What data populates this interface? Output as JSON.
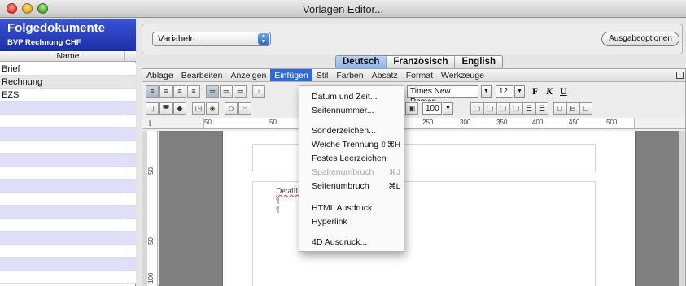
{
  "window": {
    "title": "Vorlagen Editor..."
  },
  "sidebar": {
    "title": "Folgedokumente",
    "subtitle": "BVP Rechnung CHF",
    "column_header": "Name",
    "items": [
      "Brief",
      "Rechnung",
      "EZS",
      "",
      "",
      "",
      "",
      "",
      "",
      "",
      "",
      "",
      "",
      "",
      "",
      "",
      ""
    ]
  },
  "topbar": {
    "variables_popup": "Variabeln...",
    "output_options_button": "Ausgabeoptionen"
  },
  "language_tabs": [
    "Deutsch",
    "Französisch",
    "English"
  ],
  "active_language": "Deutsch",
  "menubar": {
    "items": [
      "Ablage",
      "Bearbeiten",
      "Anzeigen",
      "Einfügen",
      "Stil",
      "Farben",
      "Absatz",
      "Format",
      "Werkzeuge"
    ],
    "active": "Einfügen"
  },
  "toolbar": {
    "font_name": "Times New Roman",
    "font_size": "12",
    "zoom": "100",
    "bold_label": "F",
    "italic_label": "K",
    "underline_label": "U"
  },
  "ruler": {
    "labels": [
      "50",
      "50",
      "250",
      "300",
      "350",
      "400",
      "450",
      "500"
    ]
  },
  "vertical_ruler": {
    "labels": [
      "50",
      "50",
      "100"
    ]
  },
  "document": {
    "body_text": "Detailli",
    "pilcrow": "¶"
  },
  "insert_menu": {
    "items": [
      {
        "label": "Datum und Zeit...",
        "shortcut": "",
        "enabled": true
      },
      {
        "label": "Seitennummer...",
        "shortcut": "",
        "enabled": true
      },
      {
        "label": "Sonderzeichen...",
        "shortcut": "",
        "enabled": true
      },
      {
        "label": "Weiche Trennung",
        "shortcut": "⇧⌘H",
        "enabled": true
      },
      {
        "label": "Festes Leerzeichen",
        "shortcut": "",
        "enabled": true
      },
      {
        "label": "Spaltenumbruch",
        "shortcut": "⌘J",
        "enabled": false
      },
      {
        "label": "Seitenumbruch",
        "shortcut": "⌘L",
        "enabled": true
      },
      {
        "label": "HTML Ausdruck",
        "shortcut": "",
        "enabled": true
      },
      {
        "label": "Hyperlink",
        "shortcut": "",
        "enabled": true
      },
      {
        "label": "4D Ausdruck...",
        "shortcut": "",
        "enabled": true
      }
    ]
  },
  "colors": {
    "sidebar_header": "#1f34b0",
    "selection_blue": "#2f6bd8",
    "row_stripe": "#dfe0f7"
  }
}
